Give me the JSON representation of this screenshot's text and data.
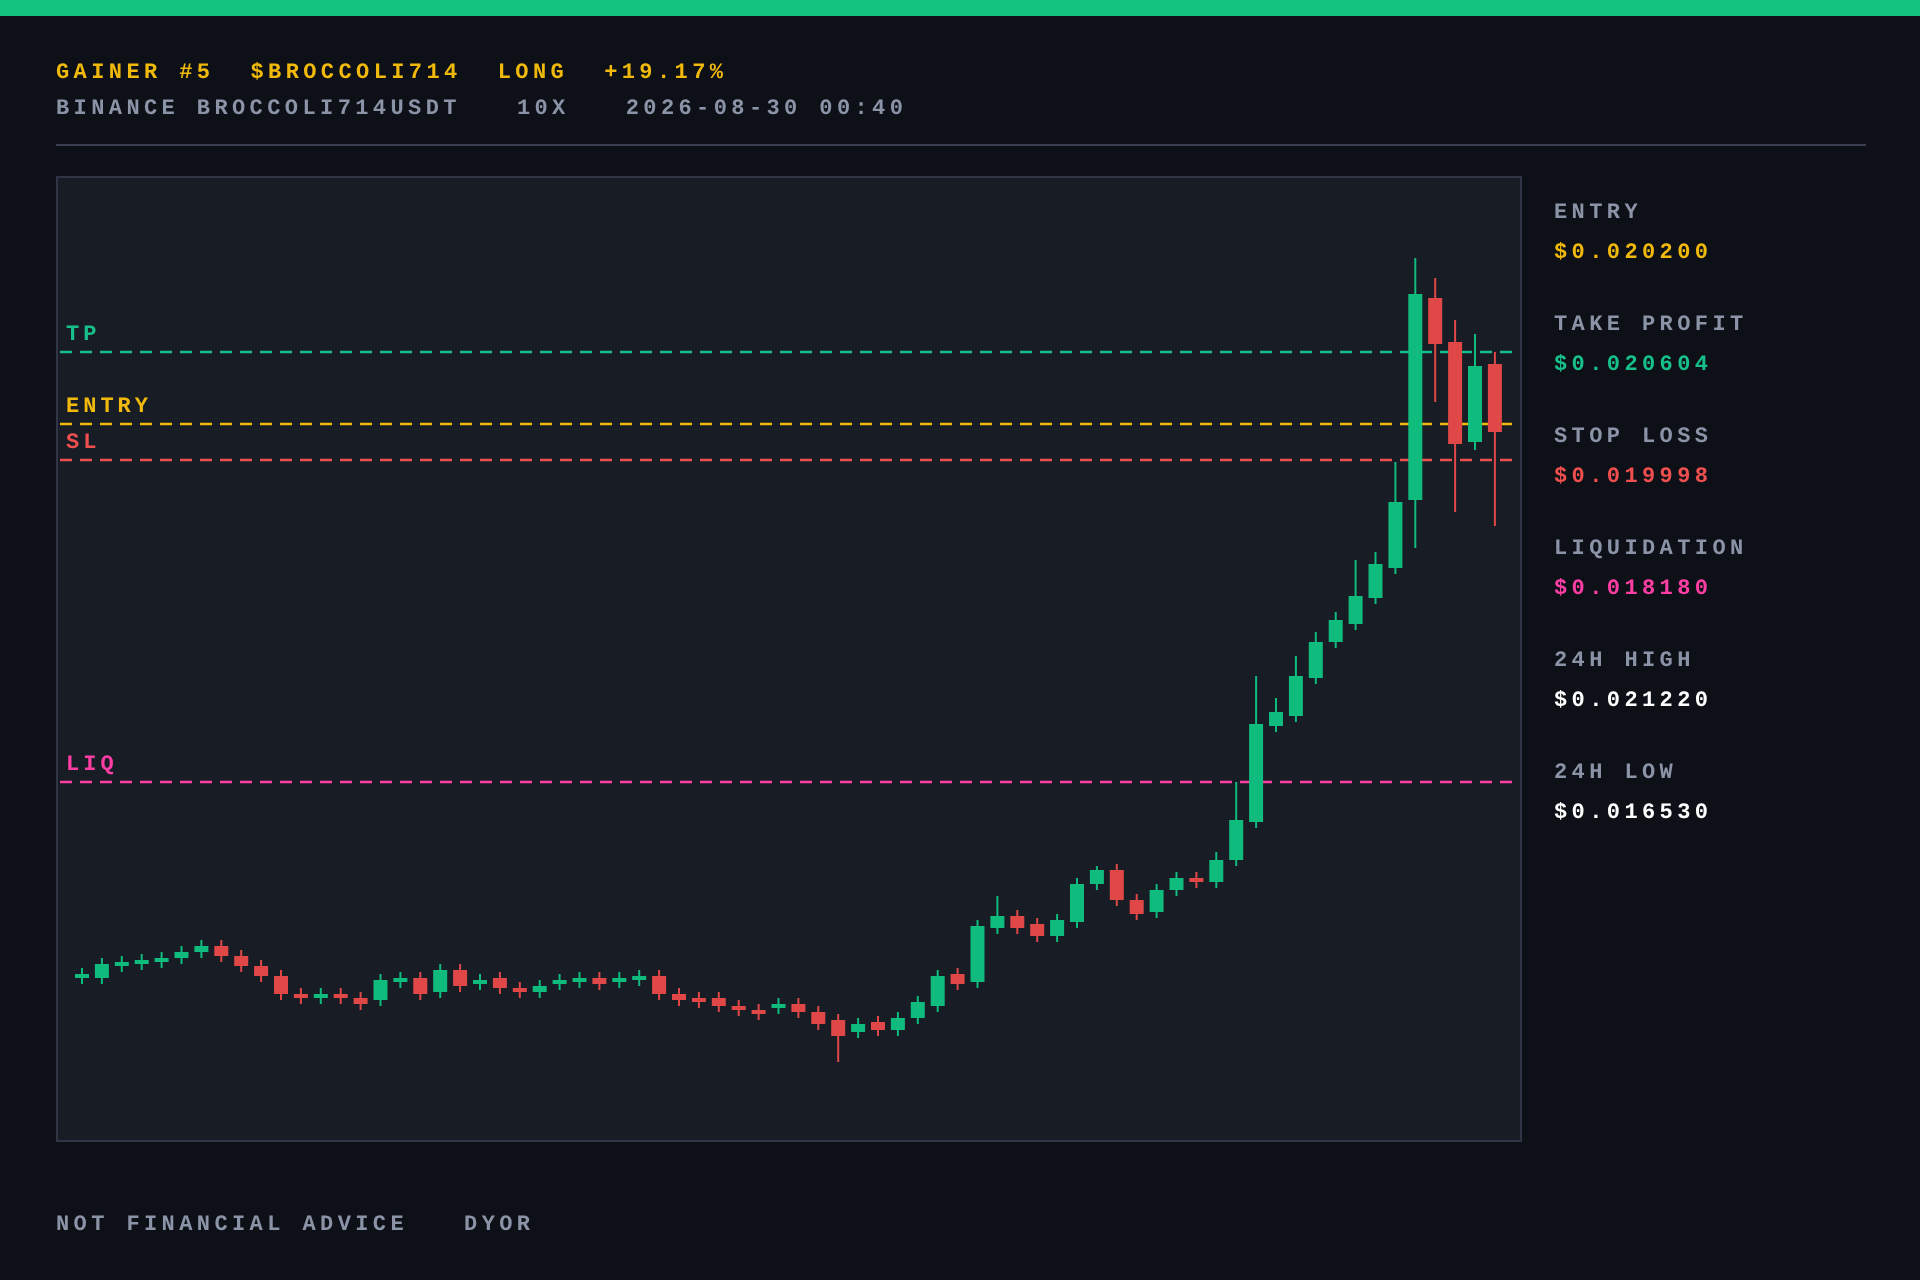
{
  "header": {
    "title_parts": [
      "GAINER #5",
      "$BROCCOLI714",
      "LONG",
      "+19.17%"
    ],
    "meta_parts": [
      "BINANCE BROCCOLI714USDT",
      "10X",
      "2026-08-30 00:40"
    ]
  },
  "chart": {
    "levels": [
      {
        "label": "TP",
        "color": "#17c08a"
      },
      {
        "label": "ENTRY",
        "color": "#f0b90b"
      },
      {
        "label": "SL",
        "color": "#ef4f4f"
      },
      {
        "label": "LIQ",
        "color": "#ff3ea5"
      }
    ]
  },
  "stats": [
    {
      "label": "ENTRY",
      "value": "$0.020200",
      "color": "#f0b90b"
    },
    {
      "label": "TAKE PROFIT",
      "value": "$0.020604",
      "color": "#17c08a"
    },
    {
      "label": "STOP LOSS",
      "value": "$0.019998",
      "color": "#ef4f4f"
    },
    {
      "label": "LIQUIDATION",
      "value": "$0.018180",
      "color": "#ff3ea5"
    },
    {
      "label": "24H HIGH",
      "value": "$0.021220",
      "color": "#ffffff"
    },
    {
      "label": "24H LOW",
      "value": "$0.016530",
      "color": "#ffffff"
    }
  ],
  "footer": [
    "NOT FINANCIAL ADVICE",
    "DYOR"
  ]
}
